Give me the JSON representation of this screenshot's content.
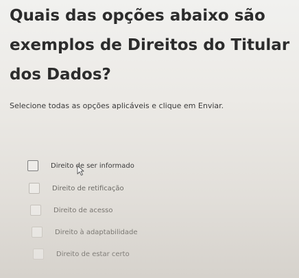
{
  "question": {
    "title": "Quais das opções abaixo são exemplos de Direitos do Titular dos Dados?"
  },
  "instruction": "Selecione todas as opções aplicáveis e clique em Enviar.",
  "options": [
    {
      "label": "Direito de ser informado",
      "checked": false
    },
    {
      "label": "Direito de retificação",
      "checked": false
    },
    {
      "label": "Direito de acesso",
      "checked": false
    },
    {
      "label": "Direito à adaptabilidade",
      "checked": false
    },
    {
      "label": "Direito de estar certo",
      "checked": false
    }
  ],
  "icons": {
    "cursor": "mouse-pointer-icon"
  },
  "colors": {
    "text": "#2c2c2c",
    "background": "#eceae6",
    "checkbox_border": "#8a8a8a"
  }
}
